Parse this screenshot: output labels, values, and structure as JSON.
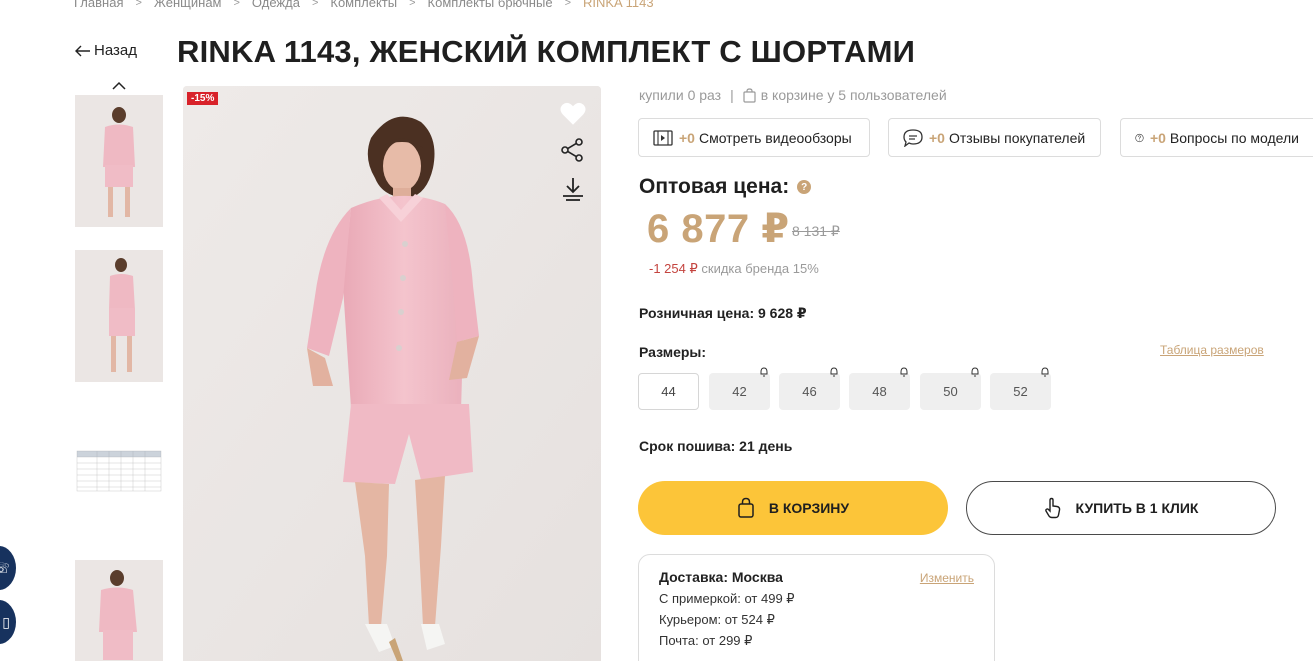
{
  "breadcrumb": [
    {
      "label": "Главная"
    },
    {
      "label": "Женщинам"
    },
    {
      "label": "Одежда"
    },
    {
      "label": "Комплекты"
    },
    {
      "label": "Комплекты брючные"
    },
    {
      "label": "RINKA 1143"
    }
  ],
  "back_label": "Назад",
  "product_title": "RINKA 1143, ЖЕНСКИЙ КОМПЛЕКТ С ШОРТАМИ",
  "discount_badge": "-15%",
  "stats": {
    "bought": "купили 0 раз",
    "separator": "|",
    "in_cart": "в корзине у 5 пользователей"
  },
  "info_pills": [
    {
      "count": "+0",
      "label": "Смотреть видеообзоры",
      "icon": "video-icon"
    },
    {
      "count": "+0",
      "label": "Отзывы покупателей",
      "icon": "chat-icon"
    },
    {
      "count": "+0",
      "label": "Вопросы по модели",
      "icon": "question-icon"
    }
  ],
  "wholesale": {
    "label": "Оптовая цена:",
    "help": "?",
    "price": "6 877 ₽",
    "old_price": "8 131 ₽",
    "discount_amount": "-1 254 ₽",
    "discount_text": "скидка бренда 15%"
  },
  "retail_price": "Розничная цена: 9 628 ₽",
  "sizes": {
    "label": "Размеры:",
    "table_link": "Таблица размеров",
    "items": [
      {
        "value": "44",
        "available": true
      },
      {
        "value": "42",
        "available": false
      },
      {
        "value": "46",
        "available": false
      },
      {
        "value": "48",
        "available": false
      },
      {
        "value": "50",
        "available": false
      },
      {
        "value": "52",
        "available": false
      }
    ]
  },
  "sewing_time": "Срок пошива: 21 день",
  "buttons": {
    "cart": "В КОРЗИНУ",
    "one_click": "КУПИТЬ В 1 КЛИК"
  },
  "delivery": {
    "title": "Доставка: Москва",
    "change": "Изменить",
    "rows": [
      "С примеркой: от 499 ₽",
      "Курьером: от 524 ₽",
      "Почта: от 299 ₽"
    ]
  },
  "colors": {
    "accent_gold": "#c9a477",
    "cart_yellow": "#fcc539",
    "badge_red": "#d8222a"
  }
}
